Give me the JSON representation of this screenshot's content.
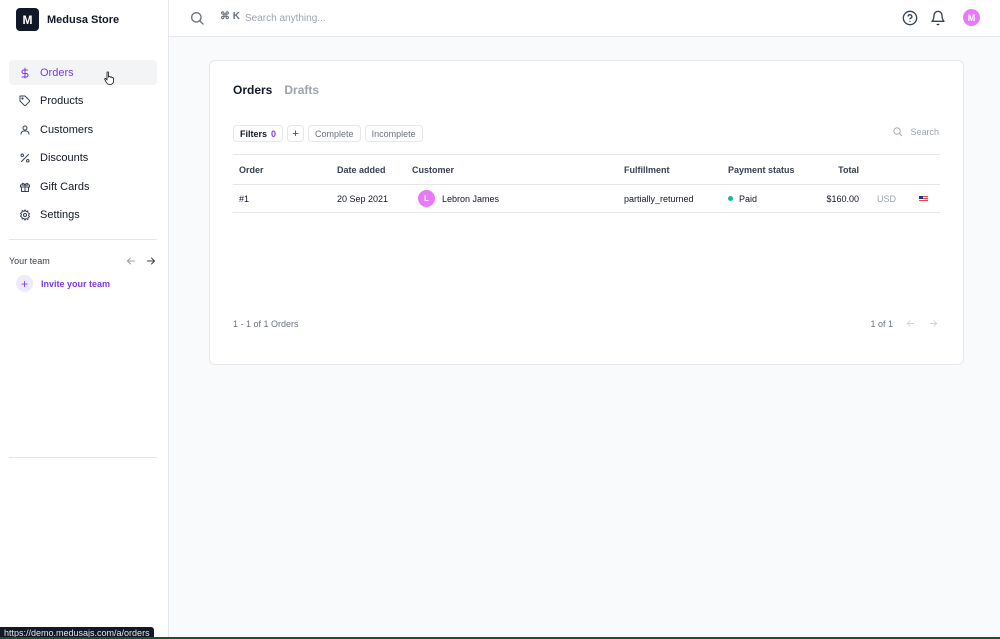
{
  "brand": {
    "logo_letter": "M",
    "name": "Medusa Store"
  },
  "sidebar": {
    "items": [
      {
        "label": "Orders",
        "icon": "dollar-icon",
        "active": true
      },
      {
        "label": "Products",
        "icon": "tag-icon",
        "active": false
      },
      {
        "label": "Customers",
        "icon": "user-icon",
        "active": false
      },
      {
        "label": "Discounts",
        "icon": "percent-icon",
        "active": false
      },
      {
        "label": "Gift Cards",
        "icon": "gift-icon",
        "active": false
      },
      {
        "label": "Settings",
        "icon": "gear-icon",
        "active": false
      }
    ],
    "team_label": "Your team",
    "invite_label": "Invite your team",
    "invite_plus": "+"
  },
  "topbar": {
    "shortcut": "⌘ K",
    "search_placeholder": "Search anything...",
    "avatar_letter": "M"
  },
  "orders": {
    "tabs": [
      "Orders",
      "Drafts"
    ],
    "filters": {
      "label": "Filters",
      "count": "0",
      "add": "+",
      "presets": [
        "Complete",
        "Incomplete"
      ]
    },
    "search_label": "Search",
    "columns": [
      "Order",
      "Date added",
      "Customer",
      "Fulfillment",
      "Payment status",
      "Total"
    ],
    "rows": [
      {
        "order": "#1",
        "date": "20 Sep 2021",
        "customer_initial": "L",
        "customer": "Lebron James",
        "fulfillment": "partially_returned",
        "payment_status": "Paid",
        "total": "$160.00",
        "currency": "USD"
      }
    ],
    "pager_summary": "1 - 1 of 1 Orders",
    "pager_pages": "1 of 1"
  },
  "status_url": "https://demo.medusajs.com/a/orders",
  "colors": {
    "accent": "#7c3aed",
    "avatar": "#e879f9",
    "paid_dot": "#14b8a6"
  }
}
